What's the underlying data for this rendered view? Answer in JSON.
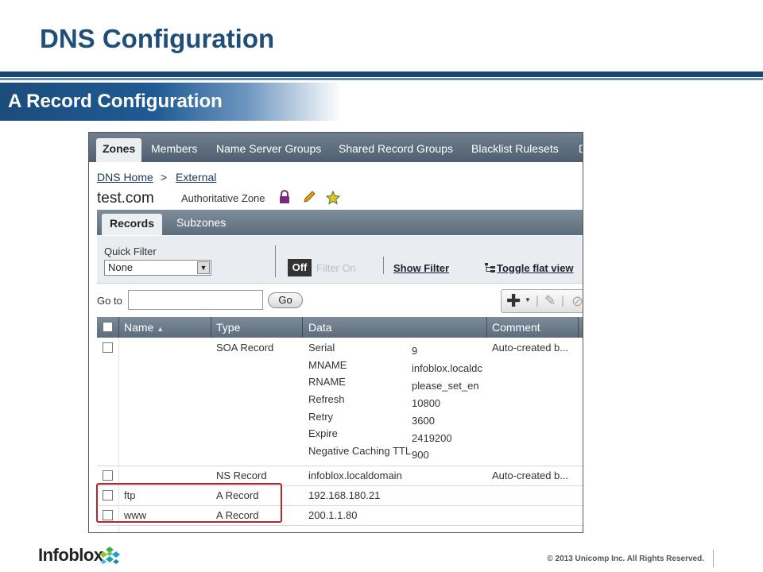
{
  "slide": {
    "title": "DNS Configuration",
    "section_title": "A Record Configuration"
  },
  "topnav": {
    "tabs": [
      "Zones",
      "Members",
      "Name Server Groups",
      "Shared Record Groups",
      "Blacklist Rulesets",
      "D"
    ]
  },
  "breadcrumb": {
    "home": "DNS Home",
    "separator": ">",
    "current": "External"
  },
  "zone": {
    "name": "test.com",
    "type": "Authoritative Zone",
    "icons": [
      "lock-icon",
      "pencil-icon",
      "star-icon"
    ]
  },
  "subtabs": [
    "Records",
    "Subzones"
  ],
  "filter": {
    "label": "Quick Filter",
    "selected": "None",
    "off_label": "Off",
    "on_label": "Filter On",
    "show_filter": "Show Filter",
    "toggle_flat": "Toggle flat view"
  },
  "goto": {
    "label": "Go to",
    "value": "",
    "button": "Go"
  },
  "grid": {
    "columns": [
      "Name",
      "Type",
      "Data",
      "Comment"
    ],
    "soa": {
      "name": "",
      "type": "SOA Record",
      "fields": [
        "Serial",
        "MNAME",
        "RNAME",
        "Refresh",
        "Retry",
        "Expire",
        "Negative Caching TTL"
      ],
      "values": [
        "9",
        "infoblox.localdc",
        "please_set_en",
        "10800",
        "3600",
        "2419200",
        "900"
      ],
      "comment": "Auto-created b..."
    },
    "rows": [
      {
        "name": "",
        "type": "NS Record",
        "data": "infoblox.localdomain",
        "comment": "Auto-created b..."
      },
      {
        "name": "ftp",
        "type": "A Record",
        "data": "192.168.180.21",
        "comment": ""
      },
      {
        "name": "www",
        "type": "A Record",
        "data": "200.1.1.80",
        "comment": ""
      }
    ]
  },
  "footer": {
    "logo": "Infoblox",
    "copyright": "© 2013 Unicomp Inc. All Rights Reserved."
  },
  "colors": {
    "title": "#1f4e79",
    "highlight": "#b3282d"
  }
}
